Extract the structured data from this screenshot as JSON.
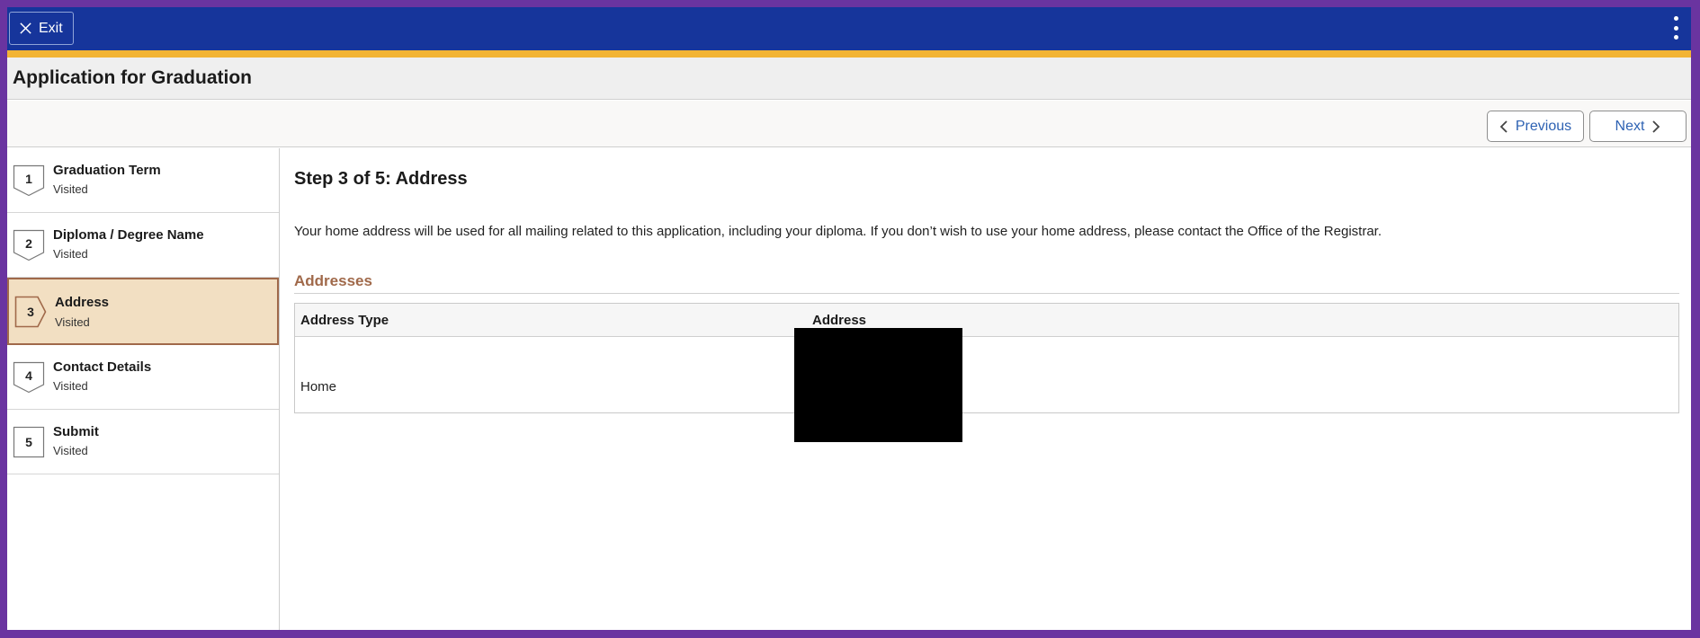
{
  "header": {
    "exit_label": "Exit",
    "brand_color": "#16359b",
    "accent_color": "#f2b434"
  },
  "page": {
    "title": "Application for Graduation"
  },
  "navigation": {
    "previous_label": "Previous",
    "next_label": "Next"
  },
  "steps": [
    {
      "number": "1",
      "title": "Graduation Term",
      "status": "Visited"
    },
    {
      "number": "2",
      "title": "Diploma / Degree Name",
      "status": "Visited"
    },
    {
      "number": "3",
      "title": "Address",
      "status": "Visited",
      "active": true
    },
    {
      "number": "4",
      "title": "Contact Details",
      "status": "Visited"
    },
    {
      "number": "5",
      "title": "Submit",
      "status": "Visited"
    }
  ],
  "main": {
    "heading": "Step 3 of 5: Address",
    "intro": "Your home address will be used for all mailing related to this application, including your diploma. If you don’t wish to use your home address, please contact the Office of the Registrar.",
    "section_title": "Addresses",
    "table": {
      "columns": [
        "Address Type",
        "Address"
      ],
      "rows": [
        {
          "type": "Home",
          "address": ""
        }
      ]
    }
  }
}
